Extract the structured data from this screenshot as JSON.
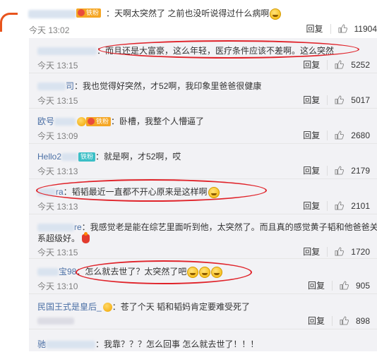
{
  "top": {
    "text": "：天啊太突然了 之前也没听说得过什么病啊",
    "badge": "铁粉",
    "time": "今天 13:02",
    "reply_label": "回复",
    "likes": "11904"
  },
  "replies": [
    {
      "text": "：而且还是大富豪，这么年轻，医疗条件应该不差啊。这么突然",
      "time": "今天 13:15",
      "reply_label": "回复",
      "likes": "5252"
    },
    {
      "name_frag": "司",
      "text": "：我也觉得好突然，才52啊，我印象里爸爸很健康",
      "time": "今天 13:15",
      "reply_label": "回复",
      "likes": "5017"
    },
    {
      "name_frag": "欧号",
      "badge": "铁粉",
      "text": "：卧槽，我整个人懵逼了",
      "time": "今天 13:09",
      "reply_label": "回复",
      "likes": "2680"
    },
    {
      "name_frag": "Hello2",
      "badge": "铁粉",
      "text": "：就是啊，才52啊，哎",
      "time": "今天 13:13",
      "reply_label": "回复",
      "likes": "2179"
    },
    {
      "name_frag": "ra",
      "text": "：韬韬最近一直都不开心原来是这样啊",
      "time": "今天 13:13",
      "reply_label": "回复",
      "likes": "2101"
    },
    {
      "name_frag": "re",
      "text": "：我感觉老是能在综艺里面听到他，太突然了。而且真的感觉黄子韬和他爸爸关",
      "text2": "系超级好。",
      "time": "今天 13:15",
      "reply_label": "回复",
      "likes": "1720"
    },
    {
      "name_frag": "宝98",
      "text": "：怎么就去世了？太突然了吧",
      "time": "今天 13:10",
      "reply_label": "回复",
      "likes": "905"
    },
    {
      "name_frag": "民国王式是皇后_",
      "text": "：苍了个天 韬和韬妈肯定要难受死了",
      "time": "",
      "reply_label": "回复",
      "likes": "898"
    },
    {
      "name_frag": "驰",
      "text": "：我靠？？？怎么回事 怎么就去世了！！！",
      "time": "",
      "reply_label": "",
      "likes": ""
    }
  ]
}
